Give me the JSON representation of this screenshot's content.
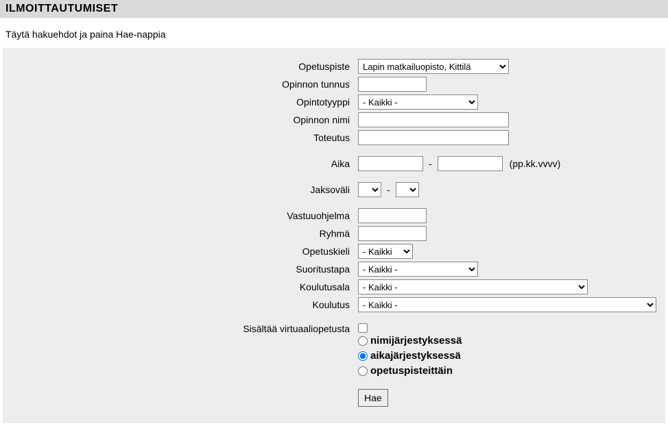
{
  "header": {
    "title": "ILMOITTAUTUMISET"
  },
  "instruction": "Täytä hakuehdot ja paina Hae-nappia",
  "form": {
    "opetuspiste": {
      "label": "Opetuspiste",
      "selected": "Lapin matkailuopisto, Kittilä"
    },
    "opinnon_tunnus": {
      "label": "Opinnon tunnus",
      "value": ""
    },
    "opintotyyppi": {
      "label": "Opintotyyppi",
      "selected": "- Kaikki -"
    },
    "opinnon_nimi": {
      "label": "Opinnon nimi",
      "value": ""
    },
    "toteutus": {
      "label": "Toteutus",
      "value": ""
    },
    "aika": {
      "label": "Aika",
      "from": "",
      "to": "",
      "hint": "(pp.kk.vvvv)",
      "sep": "-"
    },
    "jaksovali": {
      "label": "Jaksoväli",
      "from": "",
      "to": "",
      "sep": "-"
    },
    "vastuuohjelma": {
      "label": "Vastuuohjelma",
      "value": ""
    },
    "ryhma": {
      "label": "Ryhmä",
      "value": ""
    },
    "opetuskieli": {
      "label": "Opetuskieli",
      "selected": "- Kaikki -"
    },
    "suoritustapa": {
      "label": "Suoritustapa",
      "selected": "- Kaikki -"
    },
    "koulutusala": {
      "label": "Koulutusala",
      "selected": "- Kaikki -"
    },
    "koulutus": {
      "label": "Koulutus",
      "selected": "- Kaikki -"
    },
    "virtuaali": {
      "label": "Sisältää virtuaaliopetusta",
      "checked": false
    },
    "sort": {
      "nimi": "nimijärjestyksessä",
      "aika": "aikajärjestyksessä",
      "opetus": "opetuspisteittäin",
      "selected": "aika"
    },
    "submit": "Hae"
  }
}
